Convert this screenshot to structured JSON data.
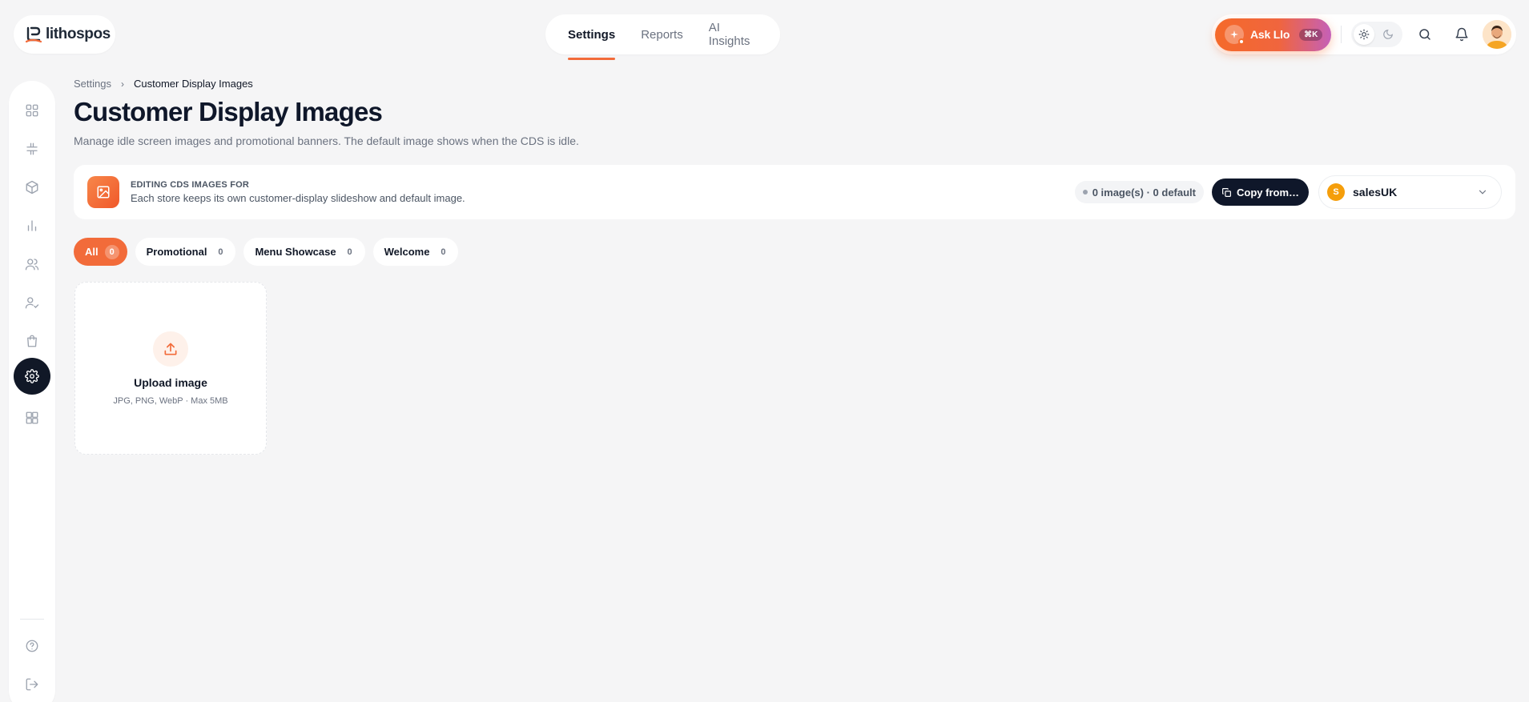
{
  "brand": {
    "name": "lithospos",
    "accent": "#f26b3a"
  },
  "topnav": {
    "tabs": [
      {
        "label": "Settings",
        "active": true
      },
      {
        "label": "Reports",
        "active": false
      },
      {
        "label": "AI Insights",
        "active": false
      }
    ]
  },
  "header_actions": {
    "ask_label": "Ask Llo",
    "ask_shortcut": "⌘K",
    "theme": "light",
    "icons": [
      "sun-icon",
      "moon-icon",
      "search-icon",
      "bell-icon",
      "avatar"
    ]
  },
  "sidebar": {
    "items": [
      {
        "icon": "dashboard-grid-icon",
        "active": false
      },
      {
        "icon": "hash-icon",
        "active": false
      },
      {
        "icon": "box-icon",
        "active": false
      },
      {
        "icon": "bar-chart-icon",
        "active": false
      },
      {
        "icon": "users-icon",
        "active": false
      },
      {
        "icon": "user-check-icon",
        "active": false
      },
      {
        "icon": "shopping-bag-icon",
        "active": false
      },
      {
        "icon": "gear-icon",
        "active": true
      },
      {
        "icon": "apps-grid-icon",
        "active": false
      }
    ],
    "bottom": [
      {
        "icon": "help-circle-icon"
      },
      {
        "icon": "logout-icon"
      }
    ]
  },
  "breadcrumb": {
    "parent": "Settings",
    "separator": "›",
    "current": "Customer Display Images"
  },
  "page": {
    "title": "Customer Display Images",
    "subtitle": "Manage idle screen images and promotional banners. The default image shows when the CDS is idle."
  },
  "store_bar": {
    "kicker": "EDITING CDS IMAGES FOR",
    "description": "Each store keeps its own customer-display slideshow and default image.",
    "count_text": "0 image(s) · 0 default",
    "copy_label": "Copy from…",
    "store_initial": "S",
    "store_name": "salesUK"
  },
  "filters": [
    {
      "label": "All",
      "count": "0",
      "active": true
    },
    {
      "label": "Promotional",
      "count": "0",
      "active": false
    },
    {
      "label": "Menu Showcase",
      "count": "0",
      "active": false
    },
    {
      "label": "Welcome",
      "count": "0",
      "active": false
    }
  ],
  "upload": {
    "title": "Upload image",
    "hint": "JPG, PNG, WebP · Max 5MB"
  }
}
